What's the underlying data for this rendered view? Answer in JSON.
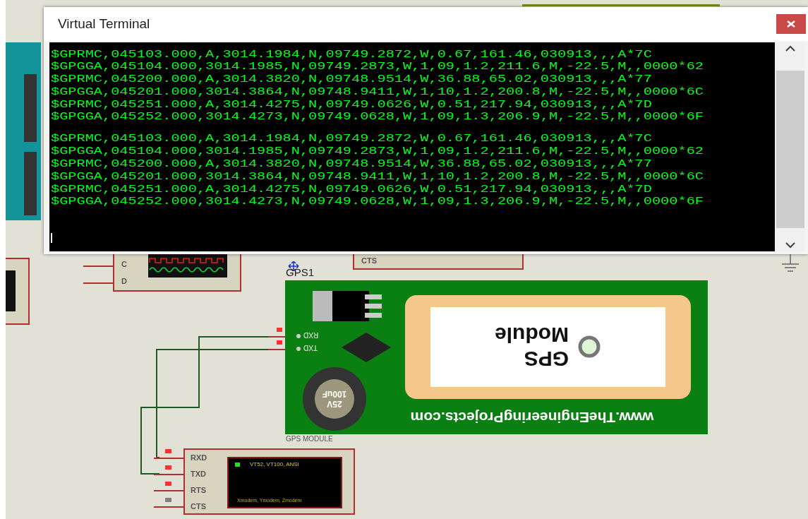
{
  "window": {
    "title": "Virtual Terminal"
  },
  "terminal": {
    "blocks": [
      [
        "$GPRMC,045103.000,A,3014.1984,N,09749.2872,W,0.67,161.46,030913,,,A*7C",
        "$GPGGA,045104.000,3014.1985,N,09749.2873,W,1,09,1.2,211.6,M,-22.5,M,,0000*62",
        "$GPRMC,045200.000,A,3014.3820,N,09748.9514,W,36.88,65.02,030913,,,A*77",
        "$GPGGA,045201.000,3014.3864,N,09748.9411,W,1,10,1.2,200.8,M,-22.5,M,,0000*6C",
        "$GPRMC,045251.000,A,3014.4275,N,09749.0626,W,0.51,217.94,030913,,,A*7D",
        "$GPGGA,045252.000,3014.4273,N,09749.0628,W,1,09,1.3,206.9,M,-22.5,M,,0000*6F"
      ],
      [
        "$GPRMC,045103.000,A,3014.1984,N,09749.2872,W,0.67,161.46,030913,,,A*7C",
        "$GPGGA,045104.000,3014.1985,N,09749.2873,W,1,09,1.2,211.6,M,-22.5,M,,0000*62",
        "$GPRMC,045200.000,A,3014.3820,N,09748.9514,W,36.88,65.02,030913,,,A*77",
        "$GPGGA,045201.000,3014.3864,N,09748.9411,W,1,10,1.2,200.8,M,-22.5,M,,0000*6C",
        "$GPRMC,045251.000,A,3014.4275,N,09749.0626,W,0.51,217.94,030913,,,A*7D",
        "$GPGGA,045252.000,3014.4273,N,09749.0628,W,1,09,1.3,206.9,M,-22.5,M,,0000*6F"
      ]
    ]
  },
  "schematic": {
    "scope": {
      "pins": [
        "C",
        "D"
      ]
    },
    "covered_part": {
      "pin": "CTS"
    },
    "gps": {
      "ref": "GPS1",
      "name": "GPS MODULE",
      "antenna_text": [
        "GPS",
        "Module"
      ],
      "url": "www.TheEngineeringProjects.com",
      "capacitor_text": [
        "25V",
        "100uF"
      ],
      "pins": [
        {
          "label": "RXD",
          "color": "#ff3030"
        },
        {
          "label": "TXD",
          "color": "#ff3030"
        }
      ]
    },
    "terminal_part": {
      "screen_text": [
        "VT52, VT100, ANSI",
        "Xmodem, Ymodem, Zmodem"
      ],
      "pins": [
        {
          "label": "RXD",
          "color": "#ff3030"
        },
        {
          "label": "TXD",
          "color": "#ff3030"
        },
        {
          "label": "RTS",
          "color": "#ff3030"
        },
        {
          "label": "CTS",
          "color": "#808080"
        }
      ]
    }
  }
}
